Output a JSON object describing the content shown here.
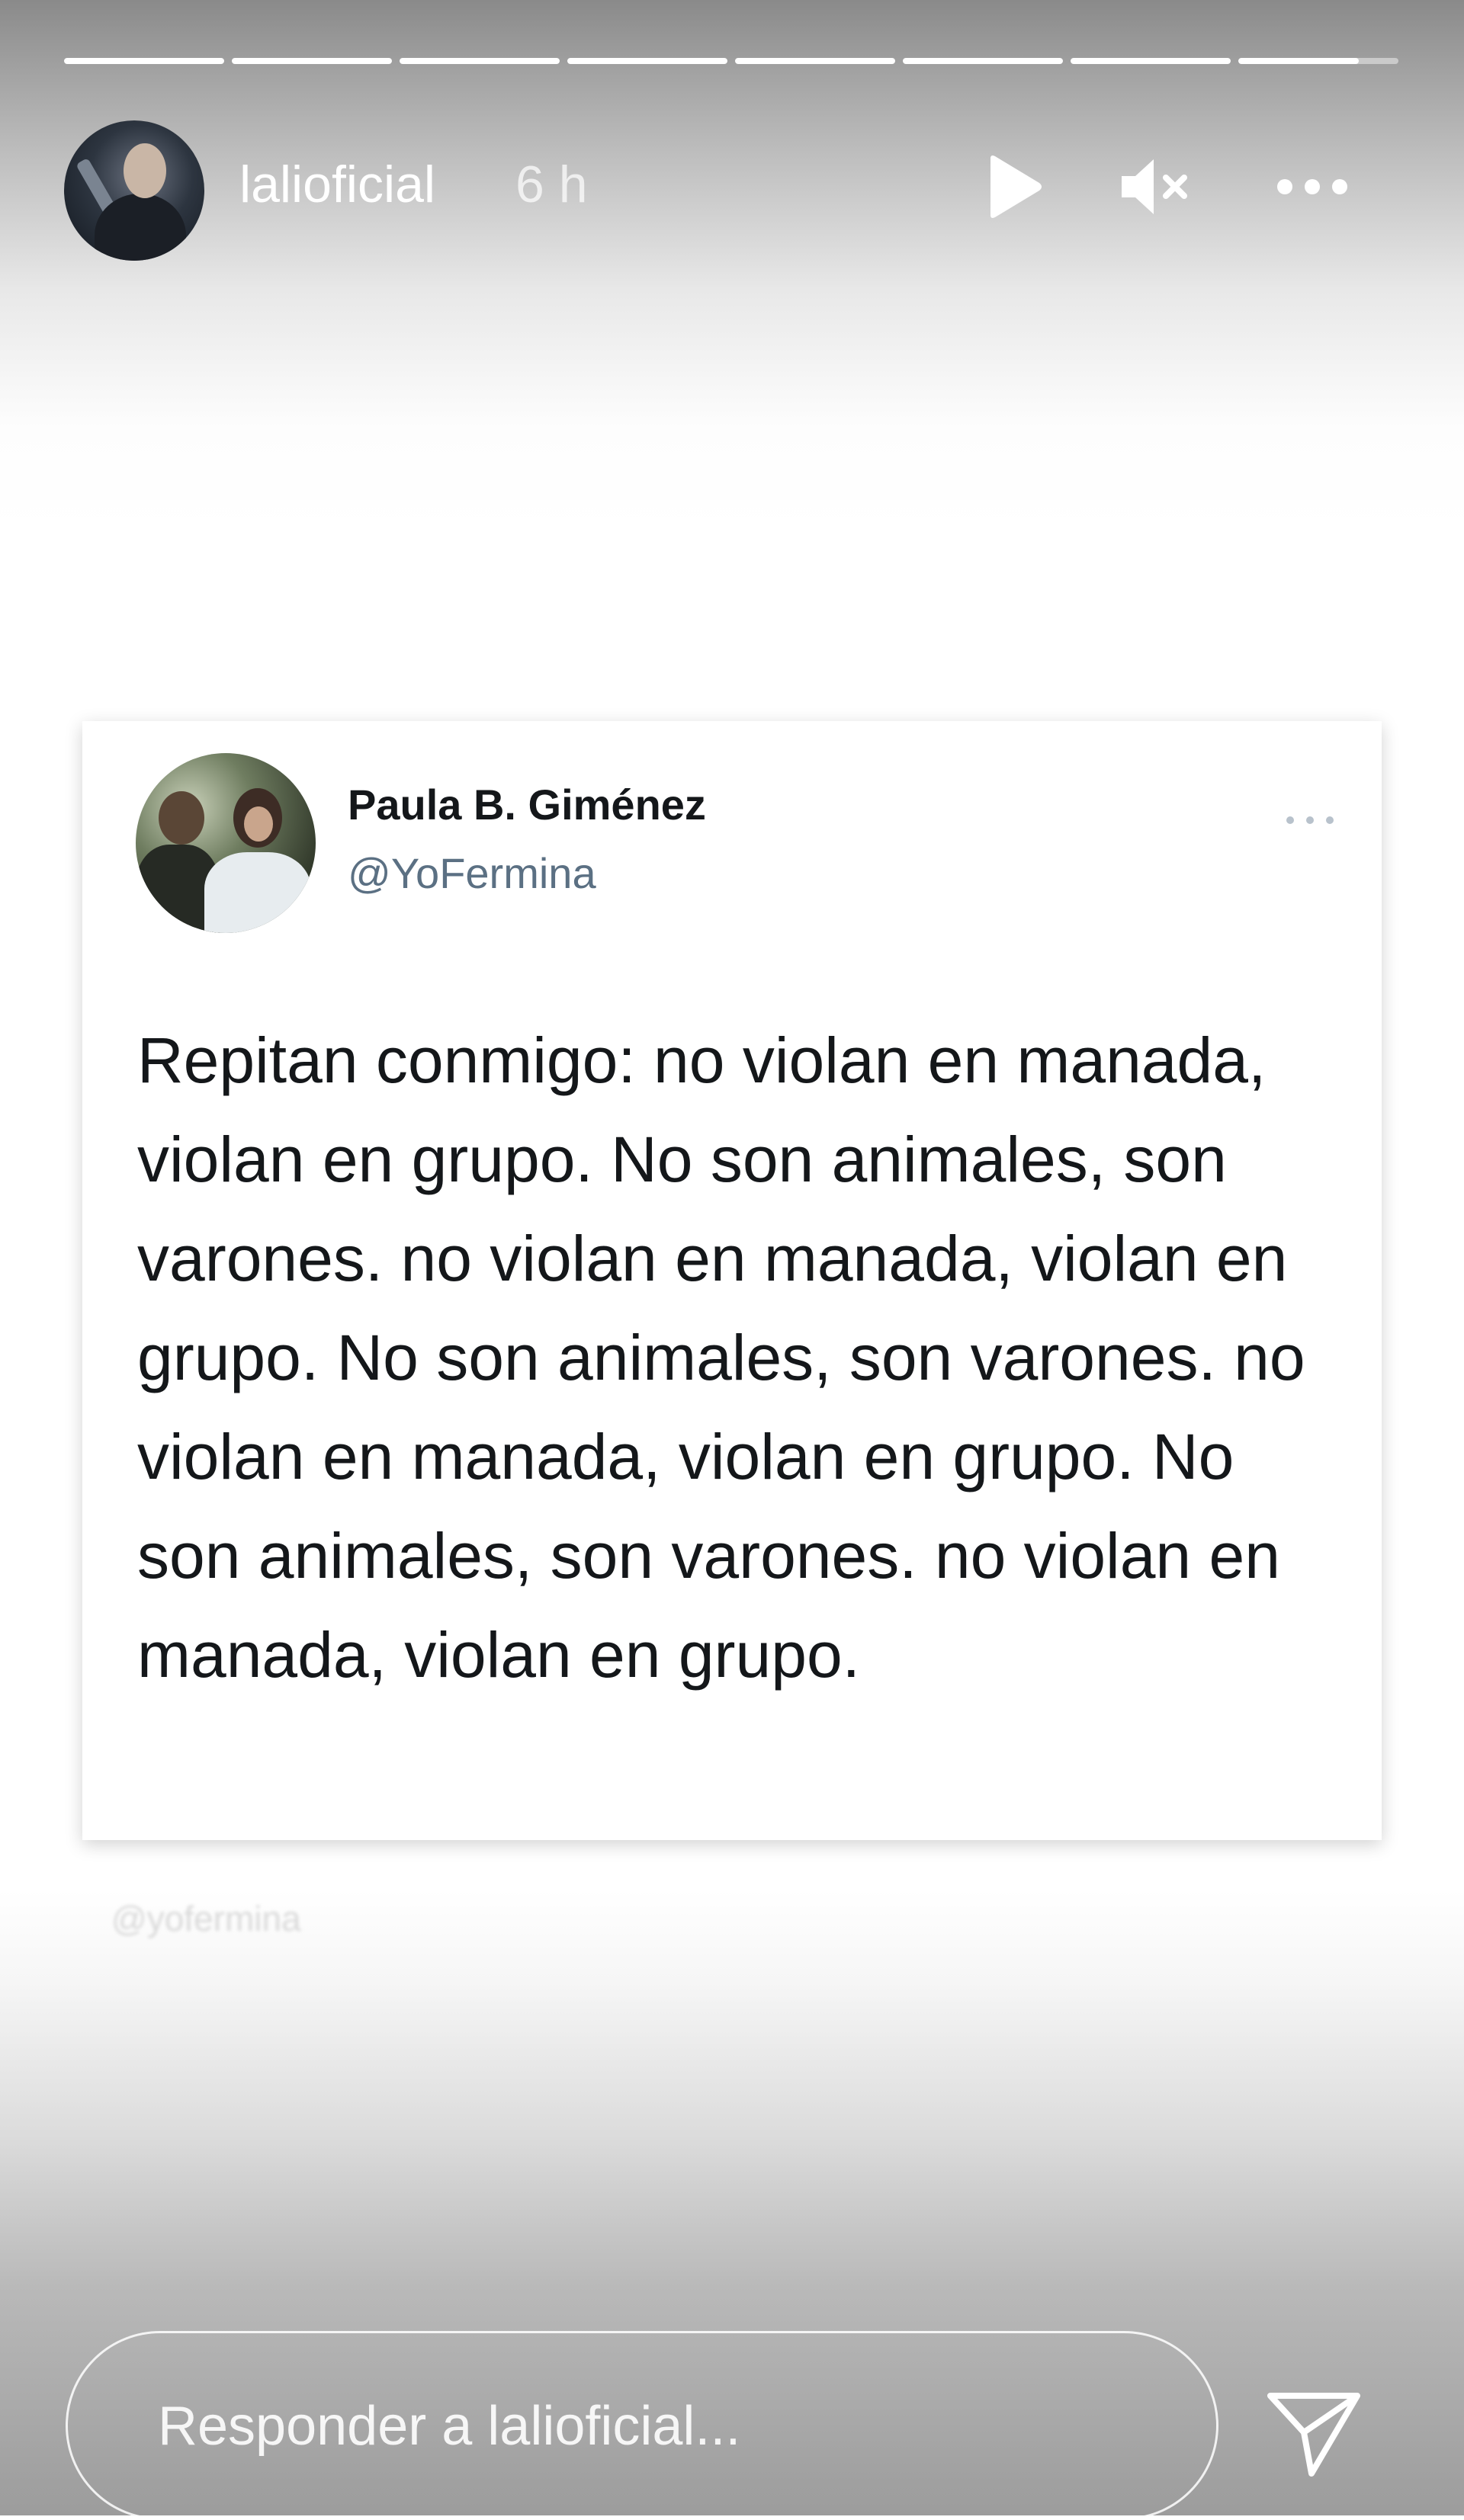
{
  "story": {
    "progress": {
      "segments": 8,
      "completed": 7,
      "current_fraction": 0.75
    },
    "header": {
      "username": "lalioficial",
      "time": "6 h",
      "play_icon": "play-icon",
      "mute_icon": "volume-muted-icon",
      "more_icon": "more-horizontal-icon"
    },
    "tweet": {
      "author_name": "Paula B. Giménez",
      "handle": "@YoFermina",
      "more_icon": "more-horizontal-icon",
      "text": "Repitan conmigo: no violan en manada, violan en grupo. No son animales, son varones. no violan en manada, violan en grupo. No son animales, son varones. no violan en manada, violan en grupo. No son animales, son varones. no violan en manada, violan en grupo."
    },
    "watermark": "@yofermina",
    "reply": {
      "placeholder": "Responder a lalioficial...",
      "send_icon": "send-icon"
    }
  }
}
